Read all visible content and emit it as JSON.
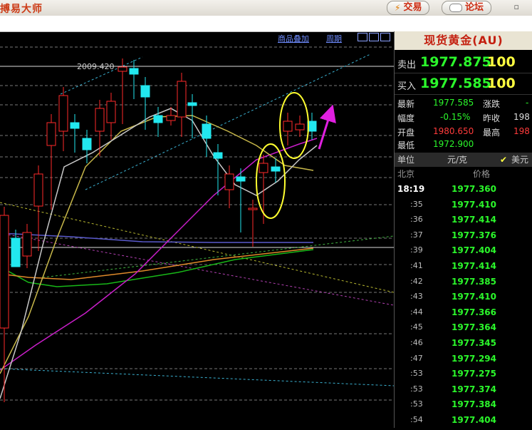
{
  "app": {
    "title": "搏易大师"
  },
  "toolbar": {
    "trade_label": "交易",
    "forum_label": "论坛"
  },
  "chart_header": {
    "overlay_label": "商品叠加",
    "period_label": "周期"
  },
  "chart_data": {
    "type": "candlestick",
    "annotation_high": "2009.420",
    "colors": {
      "up": "#ff2a2a",
      "down": "#22e8ef",
      "ma1": "#c8c8c8",
      "ma2": "#c8b84a",
      "ma3": "#c81ec8",
      "ma4": "#5a5acd",
      "ma5": "#e08a2a",
      "ma6": "#18b818"
    }
  },
  "quote": {
    "title": "现货黄金(AU)",
    "sell": {
      "label": "卖出",
      "price": "1977.875",
      "vol": "100"
    },
    "buy": {
      "label": "买入",
      "price": "1977.585",
      "vol": "100"
    },
    "stats": [
      {
        "label": "最新",
        "value": "1977.585",
        "label2": "涨跌",
        "value2": "-"
      },
      {
        "label": "幅度",
        "value": "-0.15%",
        "label2": "昨收",
        "value2": "198"
      },
      {
        "label": "开盘",
        "value": "1980.650",
        "label2": "最高",
        "value2": "198"
      },
      {
        "label": "最低",
        "value": "1972.900",
        "label2": "",
        "value2": ""
      }
    ],
    "unit_label": "单位",
    "unit_value": "元/克",
    "currency": "美元",
    "col_location": "北京",
    "col_price": "价格",
    "ticks": [
      {
        "time": "18:19",
        "price": "1977.360"
      },
      {
        "time": ":35",
        "price": "1977.410"
      },
      {
        "time": ":36",
        "price": "1977.414"
      },
      {
        "time": ":37",
        "price": "1977.376"
      },
      {
        "time": ":39",
        "price": "1977.404"
      },
      {
        "time": ":41",
        "price": "1977.414"
      },
      {
        "time": ":42",
        "price": "1977.385"
      },
      {
        "time": ":43",
        "price": "1977.410"
      },
      {
        "time": ":44",
        "price": "1977.366"
      },
      {
        "time": ":45",
        "price": "1977.364"
      },
      {
        "time": ":46",
        "price": "1977.345"
      },
      {
        "time": ":47",
        "price": "1977.294"
      },
      {
        "time": ":53",
        "price": "1977.275"
      },
      {
        "time": ":53",
        "price": "1977.374"
      },
      {
        "time": ":53",
        "price": "1977.384"
      },
      {
        "time": ":54",
        "price": "1977.404"
      }
    ]
  }
}
